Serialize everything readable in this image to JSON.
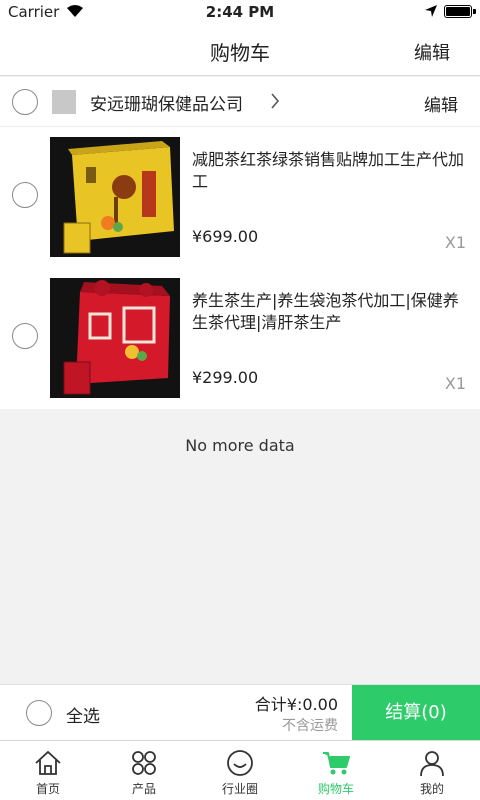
{
  "status_bar": {
    "carrier": "Carrier",
    "time": "2:44 PM"
  },
  "header": {
    "title": "购物车",
    "edit_label": "编辑"
  },
  "store": {
    "name": "安远珊瑚保健品公司",
    "edit_label": "编辑"
  },
  "cart_items": [
    {
      "name": "减肥茶红茶绿茶销售贴牌加工生产代加工",
      "price": "¥699.00",
      "qty": "X1",
      "box_color": "#e9c425"
    },
    {
      "name": "养生茶生产|养生袋泡茶代加工|保健养生茶代理|清肝茶生产",
      "price": "¥299.00",
      "qty": "X1",
      "box_color": "#d4192b"
    }
  ],
  "list_footer": "No more data",
  "checkout": {
    "select_all_label": "全选",
    "total": "合计¥:0.00",
    "shipping_note": "不含运费",
    "pay_button": "结算(0)"
  },
  "tabs": [
    {
      "label": "首页",
      "icon": "home-icon"
    },
    {
      "label": "产品",
      "icon": "grid-icon"
    },
    {
      "label": "行业圈",
      "icon": "smile-icon"
    },
    {
      "label": "购物车",
      "icon": "cart-icon",
      "active": true
    },
    {
      "label": "我的",
      "icon": "user-icon"
    }
  ],
  "colors": {
    "accent": "#2ecb6b",
    "background": "#f2f2f2"
  }
}
